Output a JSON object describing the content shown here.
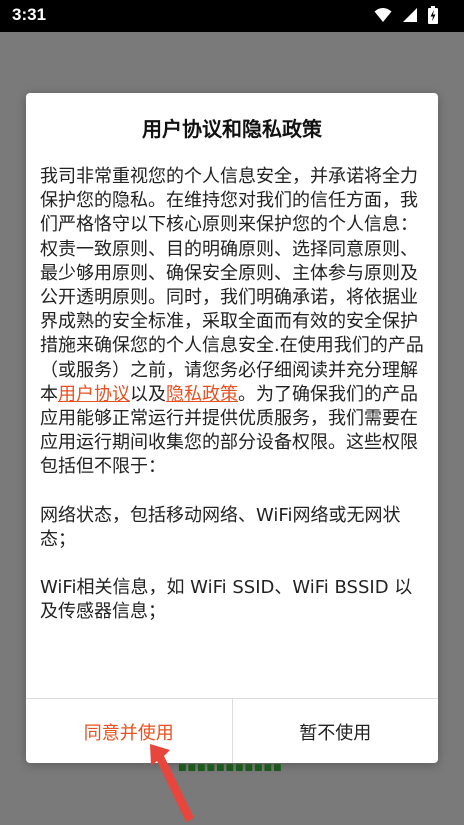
{
  "status_bar": {
    "time": "3:31",
    "icons": [
      "wifi-icon",
      "cell-signal-icon",
      "battery-charging-icon"
    ]
  },
  "dialog": {
    "title": "用户协议和隐私政策",
    "paragraph1_before_link1": "我司非常重视您的个人信息安全，并承诺将全力保护您的隐私。在维持您对我们的信任方面，我们严格恪守以下核心原则来保护您的个人信息：权责一致原则、目的明确原则、选择同意原则、最少够用原则、确保安全原则、主体参与原则及公开透明原则。同时，我们明确承诺，将依据业界成熟的安全标准，采取全面而有效的安全保护措施来确保您的个人信息安全.在使用我们的产品（或服务）之前，请您务必仔细阅读并充分理解本",
    "link_user_agreement": "用户协议",
    "text_between_links": "以及",
    "link_privacy_policy": "隐私政策",
    "paragraph1_after_link2": "。为了确保我们的产品应用能够正常运行并提供优质服务，我们需要在应用运行期间收集您的部分设备权限。这些权限包括但不限于：",
    "paragraph2": "网络状态，包括移动网络、WiFi网络或无网状态；",
    "paragraph3": "WiFi相关信息，如 WiFi SSID、WiFi BSSID 以及传感器信息；",
    "agree_button": "同意并使用",
    "decline_button": "暂不使用"
  },
  "colors": {
    "accent": "#e8501f",
    "overlay": "#7a7a7a",
    "annotation_arrow": "#e8453c"
  },
  "annotation": {
    "type": "arrow",
    "points_to": "agree_button"
  }
}
